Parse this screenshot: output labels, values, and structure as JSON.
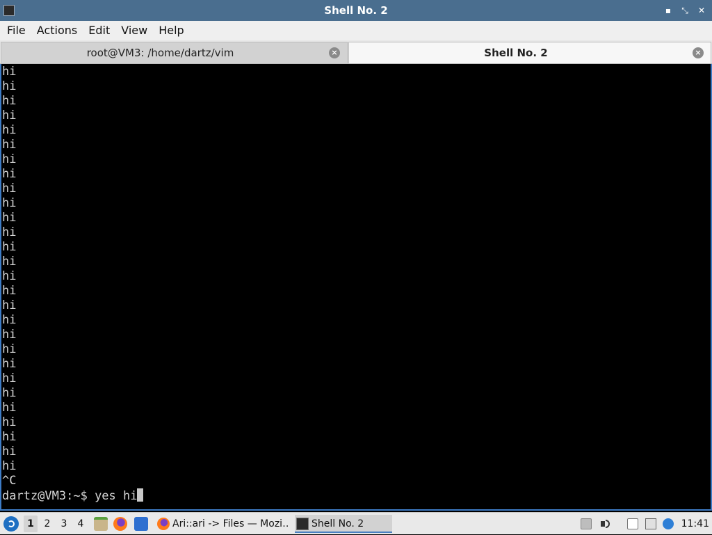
{
  "window": {
    "title": "Shell No. 2",
    "controls": {
      "minimize": "▪",
      "restore": "⤡",
      "close": "✕"
    }
  },
  "menubar": {
    "items": [
      "File",
      "Actions",
      "Edit",
      "View",
      "Help"
    ]
  },
  "tabs": [
    {
      "label": "root@VM3: /home/dartz/vim",
      "active": false
    },
    {
      "label": "Shell No. 2",
      "active": true
    }
  ],
  "terminal": {
    "output_lines": [
      "hi",
      "hi",
      "hi",
      "hi",
      "hi",
      "hi",
      "hi",
      "hi",
      "hi",
      "hi",
      "hi",
      "hi",
      "hi",
      "hi",
      "hi",
      "hi",
      "hi",
      "hi",
      "hi",
      "hi",
      "hi",
      "hi",
      "hi",
      "hi",
      "hi",
      "hi",
      "hi",
      "hi",
      "^C"
    ],
    "prompt": "dartz@VM3:~$ ",
    "command": "yes hi"
  },
  "taskbar": {
    "workspaces": [
      "1",
      "2",
      "3",
      "4"
    ],
    "active_workspace": "1",
    "tasks": [
      {
        "label": "Ari::ari -> Files — Mozi…",
        "icon": "firefox-icon"
      },
      {
        "label": "Shell No. 2",
        "icon": "terminal-icon",
        "active": true
      }
    ],
    "clock": "11:41"
  },
  "colors": {
    "titlebar": "#4a6e8f",
    "terminal_bg": "#000000",
    "terminal_fg": "#d6d6d6",
    "terminal_border": "#3d7cc6"
  }
}
